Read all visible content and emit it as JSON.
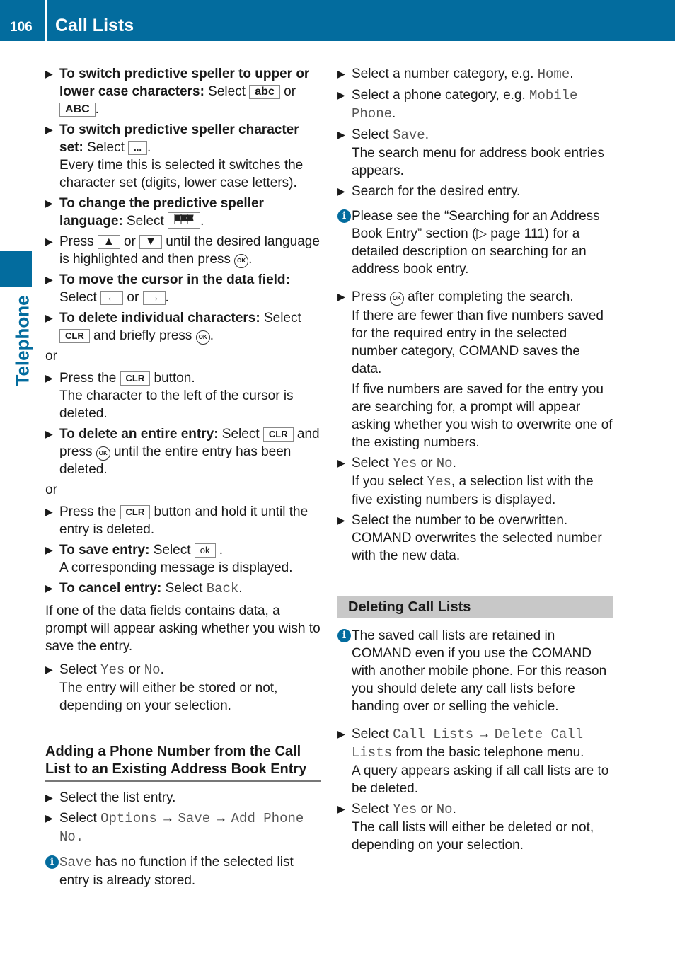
{
  "header": {
    "page_number": "106",
    "title": "Call Lists"
  },
  "side_tab": {
    "label": "Telephone"
  },
  "colors": {
    "brand": "#036c9e",
    "section_bg": "#c8c8c8"
  },
  "left": {
    "s1": {
      "bold": "To switch predictive speller to upper or lower case characters:",
      "t1": " Select ",
      "key1": "abc",
      "t2": " or ",
      "key2": "ABC",
      "t3": "."
    },
    "s2": {
      "bold": "To switch predictive speller character set:",
      "t1": " Select ",
      "key1": "...",
      "t2": ".",
      "sub": "Every time this is selected it switches the character set (digits, lower case letters)."
    },
    "s3": {
      "bold": "To change the predictive speller language:",
      "t1": " Select ",
      "t2": "."
    },
    "s4": {
      "t1": "Press ",
      "key1": "▲",
      "t2": " or ",
      "key2": "▼",
      "t3": " until the desired language is highlighted and then press ",
      "ok": "OK",
      "t4": "."
    },
    "s5": {
      "bold": "To move the cursor in the data field:",
      "t1": "Select ",
      "key1": "←",
      "t2": " or ",
      "key2": "→",
      "t3": "."
    },
    "s6": {
      "bold": "To delete individual characters:",
      "t1": " Select ",
      "key1": "CLR",
      "t2": " and briefly press ",
      "ok": "OK",
      "t3": "."
    },
    "or1": "or",
    "s7": {
      "t1": "Press the ",
      "key1": "CLR",
      "t2": " button.",
      "sub": "The character to the left of the cursor is deleted."
    },
    "s8": {
      "bold": "To delete an entire entry:",
      "t1": " Select ",
      "key1": "CLR",
      "t2": " and press ",
      "ok": "OK",
      "t3": " until the entire entry has been deleted."
    },
    "or2": "or",
    "s9": {
      "t1": "Press the ",
      "key1": "CLR",
      "t2": " button and hold it until the entry is deleted."
    },
    "s10": {
      "bold": "To save entry:",
      "t1": " Select ",
      "key1": "ok",
      "t2": " .",
      "sub": "A corresponding message is displayed."
    },
    "s11": {
      "bold": "To cancel entry:",
      "t1": " Select ",
      "m1": "Back",
      "t2": "."
    },
    "para": "If one of the data fields contains data, a prompt will appear asking whether you wish to save the entry.",
    "s12": {
      "t1": "Select ",
      "m1": "Yes",
      "t2": " or ",
      "m2": "No",
      "t3": ".",
      "sub": "The entry will either be stored or not, depending on your selection."
    },
    "heading": "Adding a Phone Number from the Call List to an Existing Address Book Entry",
    "s13": {
      "t1": "Select the list entry."
    },
    "s14": {
      "t1": "Select ",
      "m1": "Options",
      "a1": " → ",
      "m2": "Save",
      "a2": " → ",
      "m3": "Add Phone No."
    },
    "note": {
      "m1": "Save",
      "t1": " has no function if the selected list entry is already stored."
    }
  },
  "right": {
    "r1": {
      "t1": "Select a number category, e.g. ",
      "m1": "Home",
      "t2": "."
    },
    "r2": {
      "t1": "Select a phone category, e.g. ",
      "m1": "Mobile Phone",
      "t2": "."
    },
    "r3": {
      "t1": "Select ",
      "m1": "Save",
      "t2": ".",
      "sub": "The search menu for address book entries appears."
    },
    "r4": {
      "t1": "Search for the desired entry."
    },
    "note1": "Please see the “Searching for an Address Book Entry” section (▷ page 111) for a detailed description on searching for an address book entry.",
    "r5": {
      "t1": "Press ",
      "ok": "OK",
      "t2": " after completing the search.",
      "sub1": "If there are fewer than five numbers saved for the required entry in the selected number category, COMAND saves the data.",
      "sub2": "If five numbers are saved for the entry you are searching for, a prompt will appear asking whether you wish to overwrite one of the existing numbers."
    },
    "r6": {
      "t1": "Select ",
      "m1": "Yes",
      "t2": " or ",
      "m2": "No",
      "t3": ".",
      "sub_t1": "If you select ",
      "sub_m1": "Yes",
      "sub_t2": ", a selection list with the five existing numbers is displayed."
    },
    "r7": {
      "t1": "Select the number to be overwritten.",
      "sub": "COMAND overwrites the selected number with the new data."
    },
    "section": "Deleting Call Lists",
    "note2": "The saved call lists are retained in COMAND even if you use the COMAND with another mobile phone. For this reason you should delete any call lists before handing over or selling the vehicle.",
    "r8": {
      "t1": "Select ",
      "m1": "Call Lists",
      "a1": " → ",
      "m2": "Delete Call Lists",
      "t2": " from the basic telephone menu.",
      "sub": "A query appears asking if all call lists are to be deleted."
    },
    "r9": {
      "t1": "Select ",
      "m1": "Yes",
      "t2": " or ",
      "m2": "No",
      "t3": ".",
      "sub": "The call lists will either be deleted or not, depending on your selection."
    }
  }
}
